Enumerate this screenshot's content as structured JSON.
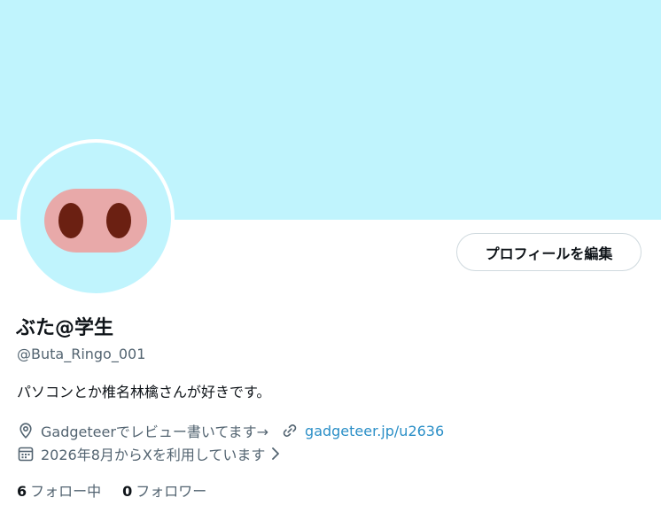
{
  "profile": {
    "display_name": "ぶた@学生",
    "handle": "@Buta_Ringo_001",
    "bio": "パソコンとか椎名林檎さんが好きです。",
    "location": "Gadgeteerでレビュー書いてます→",
    "website": "gadgeteer.jp/u2636",
    "joined": "2026年8月からXを利用しています",
    "following_count": "6",
    "following_label": "フォロー中",
    "followers_count": "0",
    "followers_label": "フォロワー"
  },
  "actions": {
    "edit_profile_label": "プロフィールを編集"
  },
  "colors": {
    "banner": "#c0f4fd",
    "avatar_bg": "#c0f4fd",
    "snout": "#e8a9a9",
    "nostril": "#6b2012",
    "link": "#2b8fc7"
  },
  "icons": {
    "location": "location-pin-icon",
    "website": "link-icon",
    "joined": "calendar-icon",
    "joined_more": "chevron-right-icon"
  }
}
